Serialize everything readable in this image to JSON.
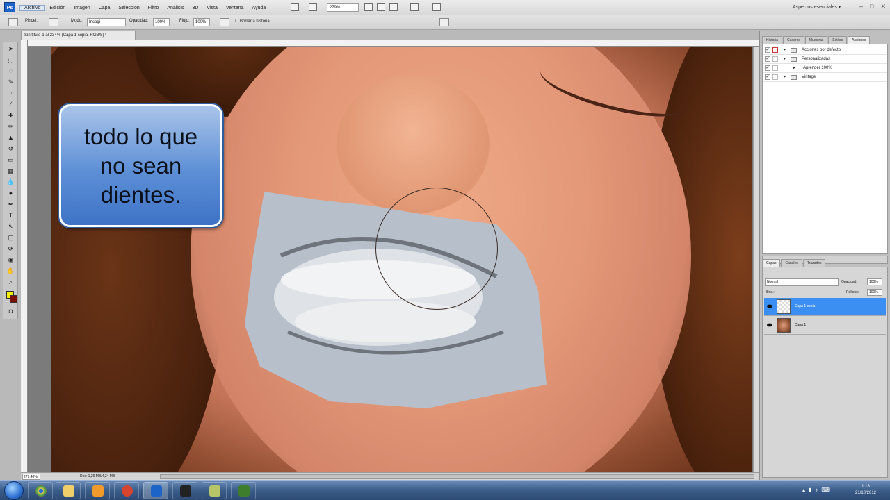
{
  "menubar": {
    "app_badge": "Ps",
    "menus": [
      "Archivo",
      "Edición",
      "Imagen",
      "Capa",
      "Selección",
      "Filtro",
      "Análisis",
      "3D",
      "Vista",
      "Ventana",
      "Ayuda"
    ],
    "zoom": "279%",
    "workspace": "Aspectos esenciales",
    "window_controls": [
      "–",
      "□",
      "✕"
    ]
  },
  "options": {
    "brush_label": "Pincel:",
    "mode_label": "Modo:",
    "mode_value": "Incogi",
    "opacity_label": "Opacidad:",
    "opacity_value": "100%",
    "flow_label": "Flujo:",
    "flow_value": "100%",
    "history_label": "Borrar a historia"
  },
  "document": {
    "tab_title": "Sin título-1 al 234% (Capa 1 copia, RGB/8) *",
    "zoom_status": "279.48%",
    "doc_status": "Doc: 1,29 MB/4,34 MB"
  },
  "callout": {
    "text": "todo lo que\nno sean\ndientes."
  },
  "panels": {
    "top_tabs": [
      "Historia",
      "Cuadros",
      "Muestras",
      "Estilos",
      "Acciones"
    ],
    "actions": [
      {
        "label": "Acciones por defecto",
        "indent": 0
      },
      {
        "label": "Personalizadas",
        "indent": 0
      },
      {
        "label": "Aprender 100%",
        "indent": 1
      },
      {
        "label": "Vintage",
        "indent": 0
      }
    ],
    "layer_tabs": [
      "Capas",
      "Canales",
      "Trazados"
    ],
    "blend_mode": "Normal",
    "opacity_label": "Opacidad:",
    "opacity_value": "100%",
    "lock_label": "Bloq.:",
    "fill_label": "Relleno:",
    "fill_value": "100%",
    "layers": [
      {
        "name": "Capa 1 copia",
        "selected": true
      },
      {
        "name": "Capa 1",
        "selected": false
      }
    ]
  },
  "taskbar": {
    "time": "1:18",
    "date": "21/10/2012"
  },
  "colors": {
    "foreground": "#f4ee00",
    "background": "#7a1000",
    "selected_layer": "#3b8ff3",
    "callout_fill": "#5d8fd6"
  }
}
